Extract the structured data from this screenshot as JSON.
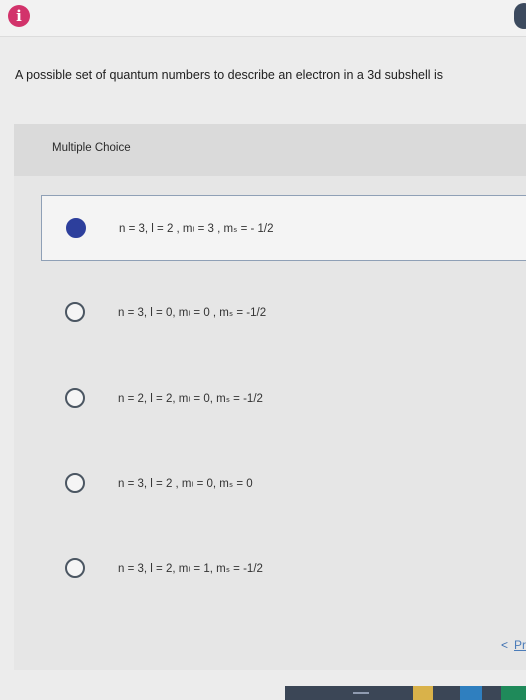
{
  "topbar": {
    "info_icon": "i"
  },
  "question": {
    "text": "A possible set of quantum numbers to describe an electron in a 3d subshell is"
  },
  "multiple_choice": {
    "label": "Multiple Choice",
    "options": [
      {
        "label": "n = 3, l = 2 , mₗ = 3 , mₛ = - 1/2",
        "selected": true
      },
      {
        "label": "n = 3, l = 0, mₗ = 0 , mₛ = -1/2",
        "selected": false
      },
      {
        "label": "n = 2, l = 2, mₗ = 0, mₛ = -1/2",
        "selected": false
      },
      {
        "label": "n = 3, l = 2 , mₗ = 0, mₛ = 0",
        "selected": false
      },
      {
        "label": "n = 3, l = 2, mₗ = 1, mₛ = -1/2",
        "selected": false
      }
    ]
  },
  "navigation": {
    "prev_chevron": "<",
    "prev_label": "Pr"
  },
  "colors": {
    "selected_radio": "#2d3f9c",
    "info_icon": "#d2336b",
    "link": "#4b7cb9"
  }
}
